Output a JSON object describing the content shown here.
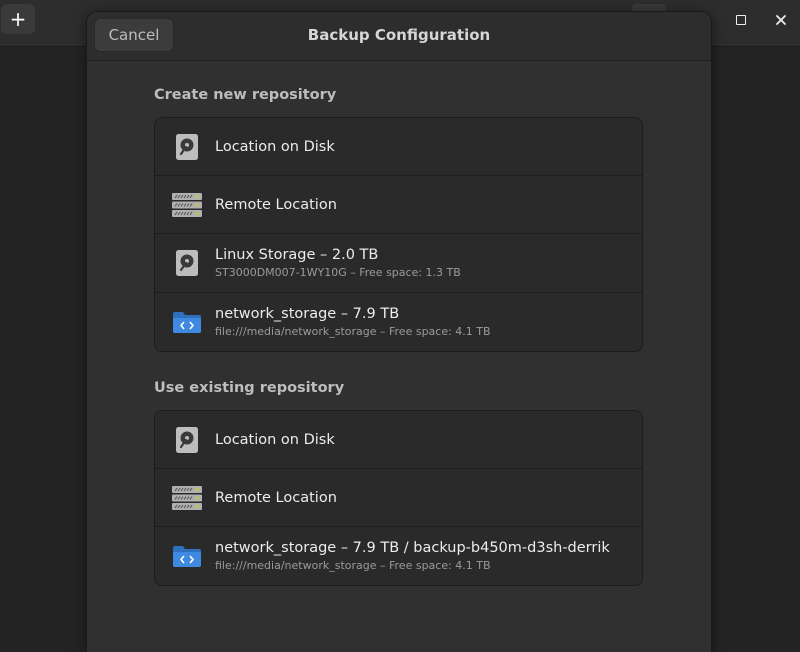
{
  "background": {
    "add_button_label": "+"
  },
  "dialog": {
    "title": "Backup Configuration",
    "cancel_label": "Cancel"
  },
  "create_section": {
    "title": "Create new repository",
    "items": [
      {
        "icon": "disk-icon",
        "title": "Location on Disk",
        "subtitle": ""
      },
      {
        "icon": "server-icon",
        "title": "Remote Location",
        "subtitle": ""
      },
      {
        "icon": "disk-icon",
        "title": "Linux Storage – 2.0 TB",
        "subtitle": "ST3000DM007-1WY10G – Free space: 1.3 TB"
      },
      {
        "icon": "network-folder-icon",
        "title": "network_storage – 7.9 TB",
        "subtitle": "file:///media/network_storage – Free space: 4.1 TB"
      }
    ]
  },
  "existing_section": {
    "title": "Use existing repository",
    "items": [
      {
        "icon": "disk-icon",
        "title": "Location on Disk",
        "subtitle": ""
      },
      {
        "icon": "server-icon",
        "title": "Remote Location",
        "subtitle": ""
      },
      {
        "icon": "network-folder-icon",
        "title": "network_storage – 7.9 TB / backup-b450m-d3sh-derrik",
        "subtitle": "file:///media/network_storage – Free space: 4.1 TB"
      }
    ]
  },
  "colors": {
    "folder_blue": "#3f8ae0",
    "disk_gray": "#bdbdbd",
    "server_gray": "#b0b0b0",
    "server_led": "#c7c24a"
  }
}
